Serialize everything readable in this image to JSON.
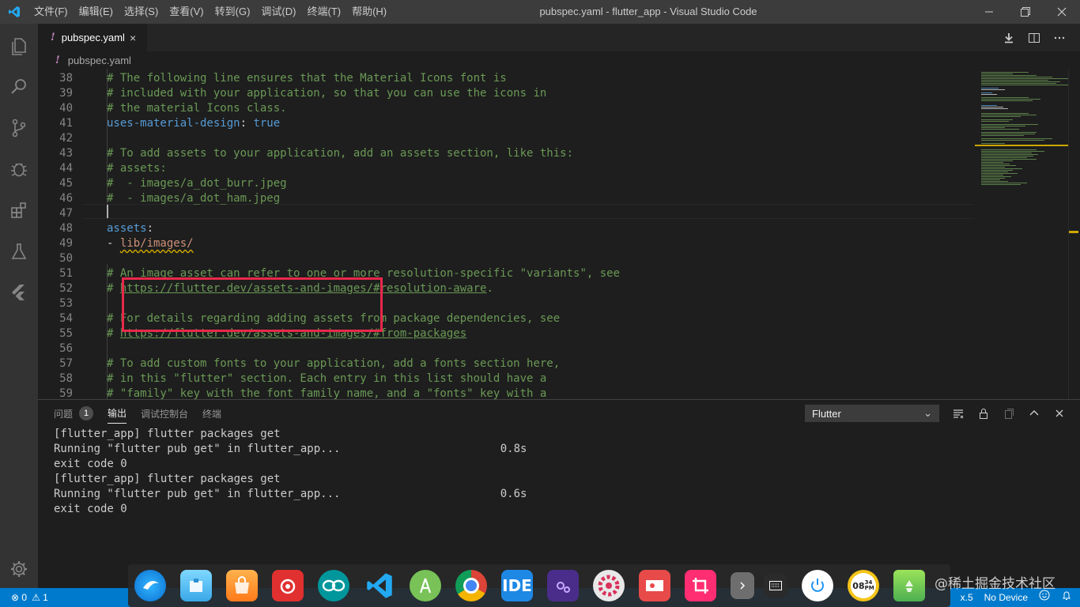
{
  "window": {
    "title": "pubspec.yaml - flutter_app - Visual Studio Code",
    "menu": [
      "文件(F)",
      "编辑(E)",
      "选择(S)",
      "查看(V)",
      "转到(G)",
      "调试(D)",
      "终端(T)",
      "帮助(H)"
    ]
  },
  "tab": {
    "icon": "!",
    "label": "pubspec.yaml",
    "close": "×"
  },
  "breadcrumb": {
    "icon": "!",
    "label": "pubspec.yaml"
  },
  "editor": {
    "lines": [
      {
        "n": "38",
        "text": "# The following line ensures that the Material Icons font is",
        "kind": "comment"
      },
      {
        "n": "39",
        "text": "# included with your application, so that you can use the icons in",
        "kind": "comment"
      },
      {
        "n": "40",
        "text": "# the material Icons class.",
        "kind": "comment"
      },
      {
        "n": "41",
        "key": "uses-material-design",
        "sep": ": ",
        "val": "true",
        "kind": "keyval"
      },
      {
        "n": "42",
        "text": "",
        "kind": "blank"
      },
      {
        "n": "43",
        "text": "# To add assets to your application, add an assets section, like this:",
        "kind": "comment"
      },
      {
        "n": "44",
        "text": "# assets:",
        "kind": "comment"
      },
      {
        "n": "45",
        "text": "#  - images/a_dot_burr.jpeg",
        "kind": "comment"
      },
      {
        "n": "46",
        "text": "#  - images/a_dot_ham.jpeg",
        "kind": "comment"
      },
      {
        "n": "47",
        "text": "",
        "kind": "blank"
      },
      {
        "n": "48",
        "key": "assets",
        "sep": ":",
        "val": "",
        "kind": "keyval"
      },
      {
        "n": "49",
        "dash": "- ",
        "val": "lib/images/",
        "kind": "list"
      },
      {
        "n": "50",
        "text": "",
        "kind": "blank"
      },
      {
        "n": "51",
        "text": "# An image asset can refer to one or more resolution-specific \"variants\", see",
        "kind": "comment"
      },
      {
        "n": "52",
        "pre": "# ",
        "link": "https://flutter.dev/assets-and-images/#resolution-aware",
        "post": ".",
        "kind": "commentlink"
      },
      {
        "n": "53",
        "text": "",
        "kind": "blank"
      },
      {
        "n": "54",
        "text": "# For details regarding adding assets from package dependencies, see",
        "kind": "comment"
      },
      {
        "n": "55",
        "pre": "# ",
        "link": "https://flutter.dev/assets-and-images/#from-packages",
        "post": "",
        "kind": "commentlink"
      },
      {
        "n": "56",
        "text": "",
        "kind": "blank"
      },
      {
        "n": "57",
        "text": "# To add custom fonts to your application, add a fonts section here,",
        "kind": "comment"
      },
      {
        "n": "58",
        "text": "# in this \"flutter\" section. Each entry in this list should have a",
        "kind": "comment"
      },
      {
        "n": "59",
        "text": "# \"family\" key with the font family name, and a \"fonts\" key with a",
        "kind": "comment"
      }
    ]
  },
  "panel": {
    "tabs": [
      {
        "label": "问题",
        "badge": "1"
      },
      {
        "label": "输出"
      },
      {
        "label": "调试控制台"
      },
      {
        "label": "终端"
      }
    ],
    "select": "Flutter",
    "output": [
      "[flutter_app] flutter packages get",
      "Running \"flutter pub get\" in flutter_app...                        0.8s",
      "exit code 0",
      "[flutter_app] flutter packages get",
      "Running \"flutter pub get\" in flutter_app...                        0.6s",
      "exit code 0"
    ]
  },
  "status": {
    "errors": "⊗ 0",
    "warnings": "⚠ 1",
    "partial": "x.5",
    "device": "No Device"
  },
  "dock": {
    "apps": [
      "deepin-launcher",
      "file-manager",
      "app-store",
      "netease-music",
      "arduino",
      "vscode",
      "android-studio",
      "chrome",
      "ide",
      "plugin",
      "settings",
      "screen-recorder",
      "screenshot",
      "chevron",
      "keyboard",
      "power",
      "clock",
      "trash"
    ],
    "ide_label": "IDE",
    "clock_hour": "08",
    "clock_min": "34",
    "clock_ampm": "PM"
  },
  "watermark": "@稀土掘金技术社区",
  "colors": {
    "accent": "#007acc",
    "highlight": "#e8284a",
    "comment": "#6a9955",
    "key": "#569cd6",
    "string": "#ce9178"
  }
}
